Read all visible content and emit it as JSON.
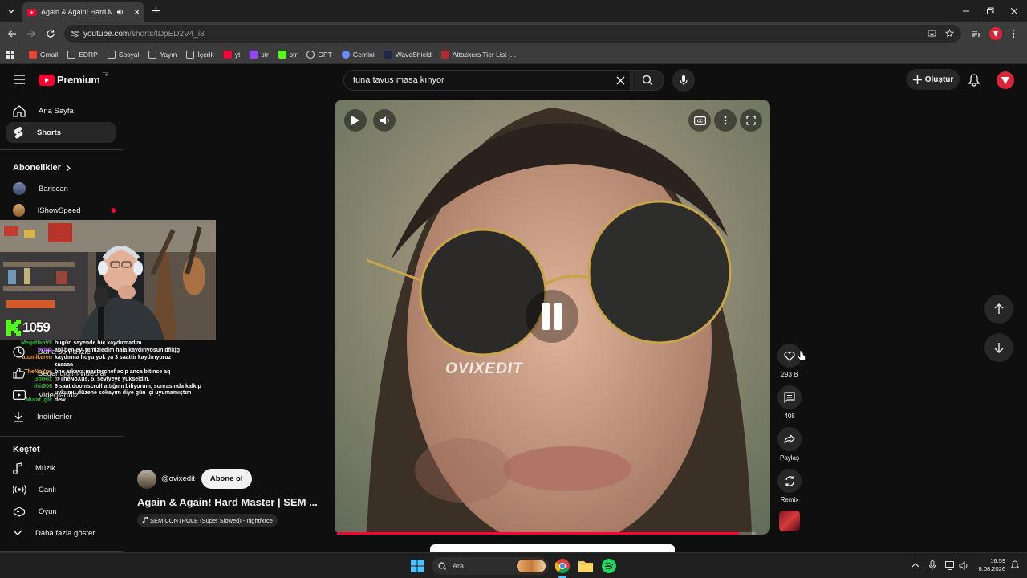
{
  "browser": {
    "tab_title": "Again & Again! Hard Master | SEM CONTROLE",
    "url_host": "youtube.com",
    "url_path": "/shorts/tDpED2V4_i8",
    "bookmarks": [
      "Gmail",
      "EDRP",
      "Sosyal",
      "Yayın",
      "İçerik",
      "yt",
      "str",
      "str",
      "GPT",
      "Gemini",
      "WaveShield",
      "Attackers Tier List |..."
    ]
  },
  "youtube": {
    "logo_text": "Premium",
    "logo_badge": "TR",
    "search_value": "tuna tavus masa kınyor",
    "create_label": "Oluştur"
  },
  "sidebar": {
    "home": "Ana Sayfa",
    "shorts": "Shorts",
    "subscriptions_header": "Abonelikler",
    "subs": [
      "Bariscan",
      "IShowSpeed"
    ],
    "you_items": [
      "Daha sonra izle",
      "Beğendiğim videolar",
      "Videolarınız",
      "İndirilenler"
    ],
    "explore_header": "Keşfet",
    "explore": [
      "Müzik",
      "Canlı",
      "Oyun"
    ],
    "show_more": "Daha fazla göster"
  },
  "stream": {
    "kick_count": "1059",
    "chat": [
      {
        "user": "MegatlanVII",
        "color": "#3cb043",
        "msg": "bugün sayende hiç kaydırmadım"
      },
      {
        "user": "ixtivh",
        "color": "#9b59ff",
        "msg": "abi ben evi temizledim hala kaydırıyosun dflkjg"
      },
      {
        "user": "atomikeren",
        "color": "#e8a23a",
        "msg": "kaydırma huyu yok ya 3 saattir kaydırıyoruz"
      },
      {
        "user": "",
        "color": "#ffffff",
        "msg": "zaaaaa"
      },
      {
        "user": "TheNoXus",
        "color": "#e8a23a",
        "msg": "bne arkaya masterchef acıp anca bitince aq"
      },
      {
        "user": "BotRix",
        "color": "#3cb043",
        "msg": "@TheNoXus, 5. seviyeye yükseldin."
      },
      {
        "user": "ifrit606",
        "color": "#3cb043",
        "msg": "6 saat doomscroll attığımı biliyorum, sonrasında kalkıp uykumu düzene sokayım diye gün içi uyumamıştım"
      },
      {
        "user": "Murat_glk",
        "color": "#3cb043",
        "msg": "dew"
      }
    ]
  },
  "short": {
    "watermark": "OVIXEDIT",
    "channel": "@ovixedit",
    "subscribe_label": "Abone ol",
    "title": "Again & Again! Hard Master | SEM ...",
    "music": "SEM CONTROLE (Super Slowed) - nightfxrce",
    "likes": "293 B",
    "comments": "408",
    "share": "Paylaş",
    "remix": "Remix",
    "progress": 0.96
  },
  "taskbar": {
    "search_placeholder": "Ara",
    "time": "16:59",
    "date": "8.08.2026"
  }
}
